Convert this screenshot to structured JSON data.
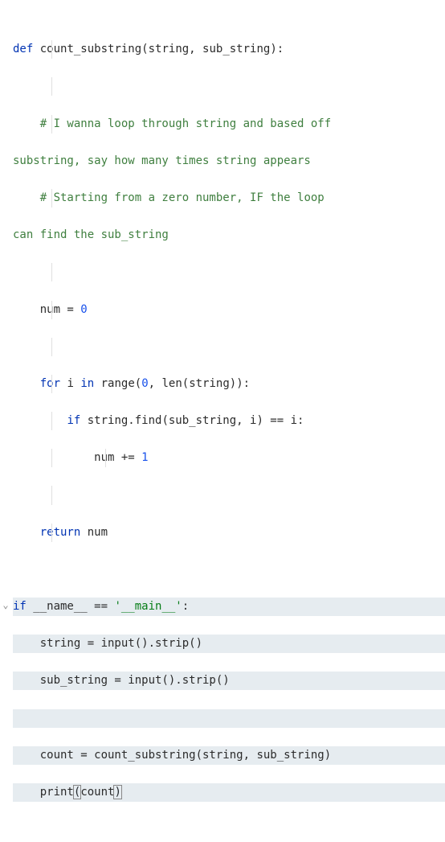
{
  "code": {
    "l1_def": "def",
    "l1_fn": "count_substring",
    "l1_params": "(string, sub_string):",
    "l3_comment": "# I wanna loop through string and based off",
    "l4_comment": "substring, say how many times string appears",
    "l5_comment": "# Starting from a zero number, IF the loop",
    "l6_comment": "can find the sub_string",
    "l8_num": "num = ",
    "l8_zero": "0",
    "l10_for": "for",
    "l10_rest1": " i ",
    "l10_in": "in",
    "l10_range": " range(",
    "l10_zero": "0",
    "l10_rest2": ", len(string)):",
    "l11_if": "if",
    "l11_rest": " string.find(sub_string, i) == i:",
    "l12_body": "num += ",
    "l12_one": "1",
    "l14_return": "return",
    "l14_val": " num",
    "l16_if": "if",
    "l16_name": " __name__ == ",
    "l16_str": "'__main__'",
    "l16_colon": ":",
    "l17": "string = input().strip()",
    "l18": "sub_string = input().strip()",
    "l20": "count = count_substring(string, sub_string)",
    "l21_print": "print",
    "l21_open": "(",
    "l21_arg": "count",
    "l21_close": ")"
  },
  "gutter": {
    "fold": "⌄"
  }
}
